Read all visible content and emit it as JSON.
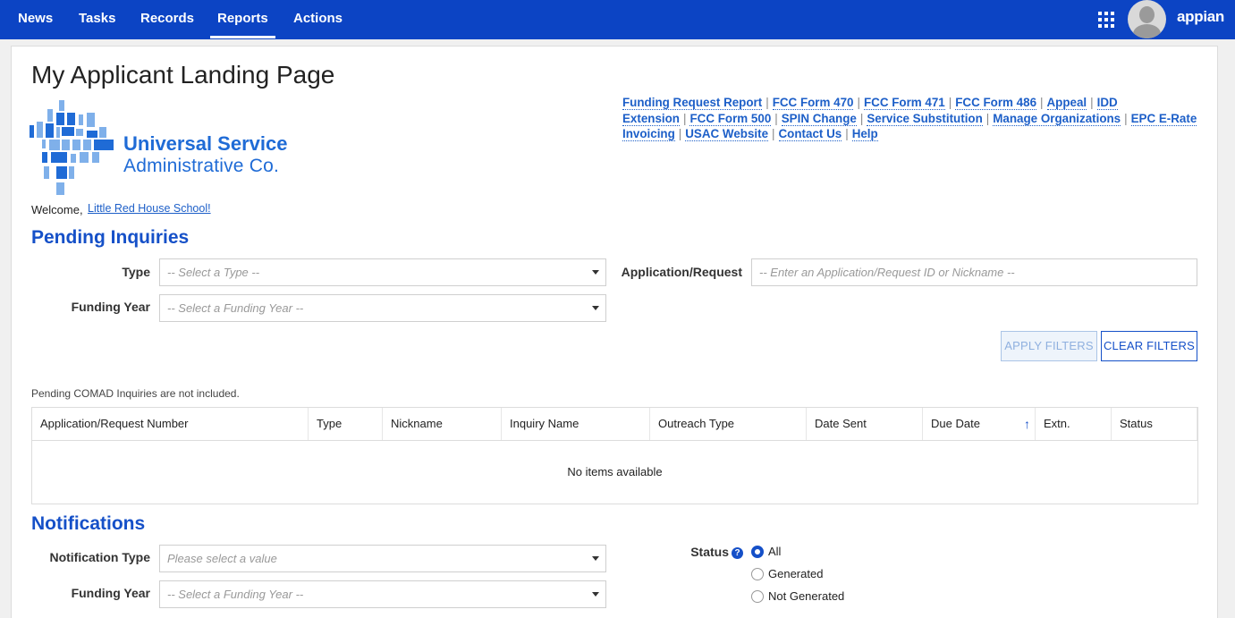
{
  "nav": {
    "items": [
      {
        "label": "News",
        "active": false
      },
      {
        "label": "Tasks",
        "active": false
      },
      {
        "label": "Records",
        "active": false
      },
      {
        "label": "Reports",
        "active": true
      },
      {
        "label": "Actions",
        "active": false
      }
    ],
    "apps_icon": "grid-icon",
    "avatar_icon": "user-avatar-icon",
    "brand": "appian",
    "colors": {
      "bar": "#0c44c4",
      "accent": "#1550c8"
    }
  },
  "page": {
    "title": "My Applicant Landing Page"
  },
  "logo": {
    "line1": "Universal Service",
    "line2": "Administrative Co."
  },
  "quick_links": [
    "Funding Request Report",
    "FCC Form 470",
    "FCC Form 471",
    "FCC Form 486",
    "Appeal",
    "IDD Extension",
    "FCC Form 500",
    "SPIN Change",
    "Service Substitution",
    "Manage Organizations",
    "EPC E-Rate Invoicing",
    "USAC Website",
    "Contact Us",
    "Help"
  ],
  "link_separator": "|",
  "welcome": {
    "prefix": "Welcome,",
    "org_link": "Little Red House School!"
  },
  "pending": {
    "title": "Pending Inquiries",
    "type_label": "Type",
    "type_placeholder": "-- Select a Type --",
    "fy_label": "Funding Year",
    "fy_placeholder": "-- Select a Funding Year --",
    "app_label": "Application/Request",
    "app_placeholder": "-- Enter an Application/Request ID or Nickname --",
    "apply_button": "APPLY FILTERS",
    "clear_button": "CLEAR FILTERS",
    "note": "Pending COMAD Inquiries are not included.",
    "columns": [
      "Application/Request Number",
      "Type",
      "Nickname",
      "Inquiry Name",
      "Outreach Type",
      "Date Sent",
      "Due Date",
      "Extn.",
      "Status"
    ],
    "sort_indicator": "↑",
    "empty_text": "No items available"
  },
  "notifications": {
    "title": "Notifications",
    "type_label": "Notification Type",
    "type_placeholder": "Please select a value",
    "fy_label": "Funding Year",
    "fy_placeholder": "-- Select a Funding Year --",
    "status_label": "Status",
    "status_help": "?",
    "status_options": [
      {
        "label": "All",
        "selected": true
      },
      {
        "label": "Generated",
        "selected": false
      },
      {
        "label": "Not Generated",
        "selected": false
      }
    ]
  }
}
